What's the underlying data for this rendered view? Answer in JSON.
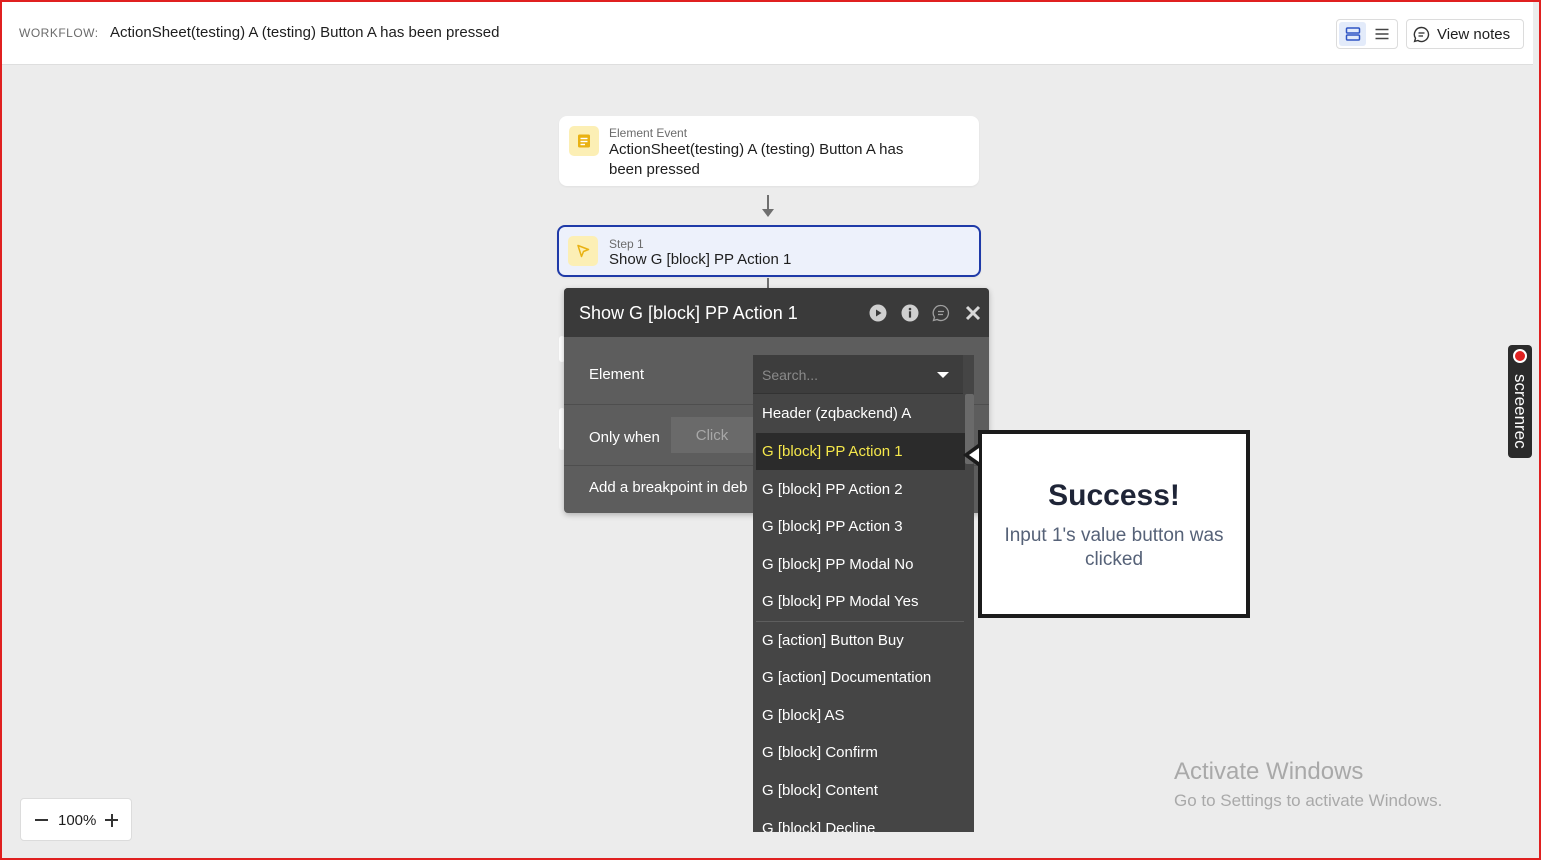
{
  "header": {
    "workflow_label": "WORKFLOW:",
    "workflow_title": "ActionSheet(testing) A (testing) Button A has been pressed",
    "view_notes_label": "View notes"
  },
  "event_card": {
    "kicker": "Element Event",
    "title": "ActionSheet(testing) A (testing) Button A has been pressed"
  },
  "step_card": {
    "kicker": "Step 1",
    "title": "Show G [block] PP Action 1"
  },
  "action_panel": {
    "title": "Show G [block] PP Action 1",
    "element_label": "Element",
    "only_when_label": "Only when",
    "only_when_placeholder": "Click",
    "breakpoint_label": "Add a breakpoint in deb"
  },
  "element_dropdown": {
    "placeholder": "Search...",
    "selected_index": 1,
    "items": [
      "Header (zqbackend) A",
      "G [block] PP Action 1",
      "G [block] PP Action 2",
      "G [block] PP Action 3",
      "G [block] PP Modal No",
      "G [block] PP Modal Yes",
      "G [action] Button Buy",
      "G [action] Documentation",
      "G [block] AS",
      "G [block] Confirm",
      "G [block] Content",
      "G [block] Decline"
    ]
  },
  "toast": {
    "title": "Success!",
    "message": "Input 1's value button was clicked"
  },
  "screenrec": {
    "label": "screenrec"
  },
  "watermark": {
    "title": "Activate Windows",
    "subtitle": "Go to Settings to activate Windows."
  },
  "zoom": {
    "value": "100%"
  },
  "colors": {
    "accent": "#1f3aa8",
    "selected_item": "#f5e74b",
    "panel_bg": "#5d5d5d",
    "frame": "#e02020"
  }
}
